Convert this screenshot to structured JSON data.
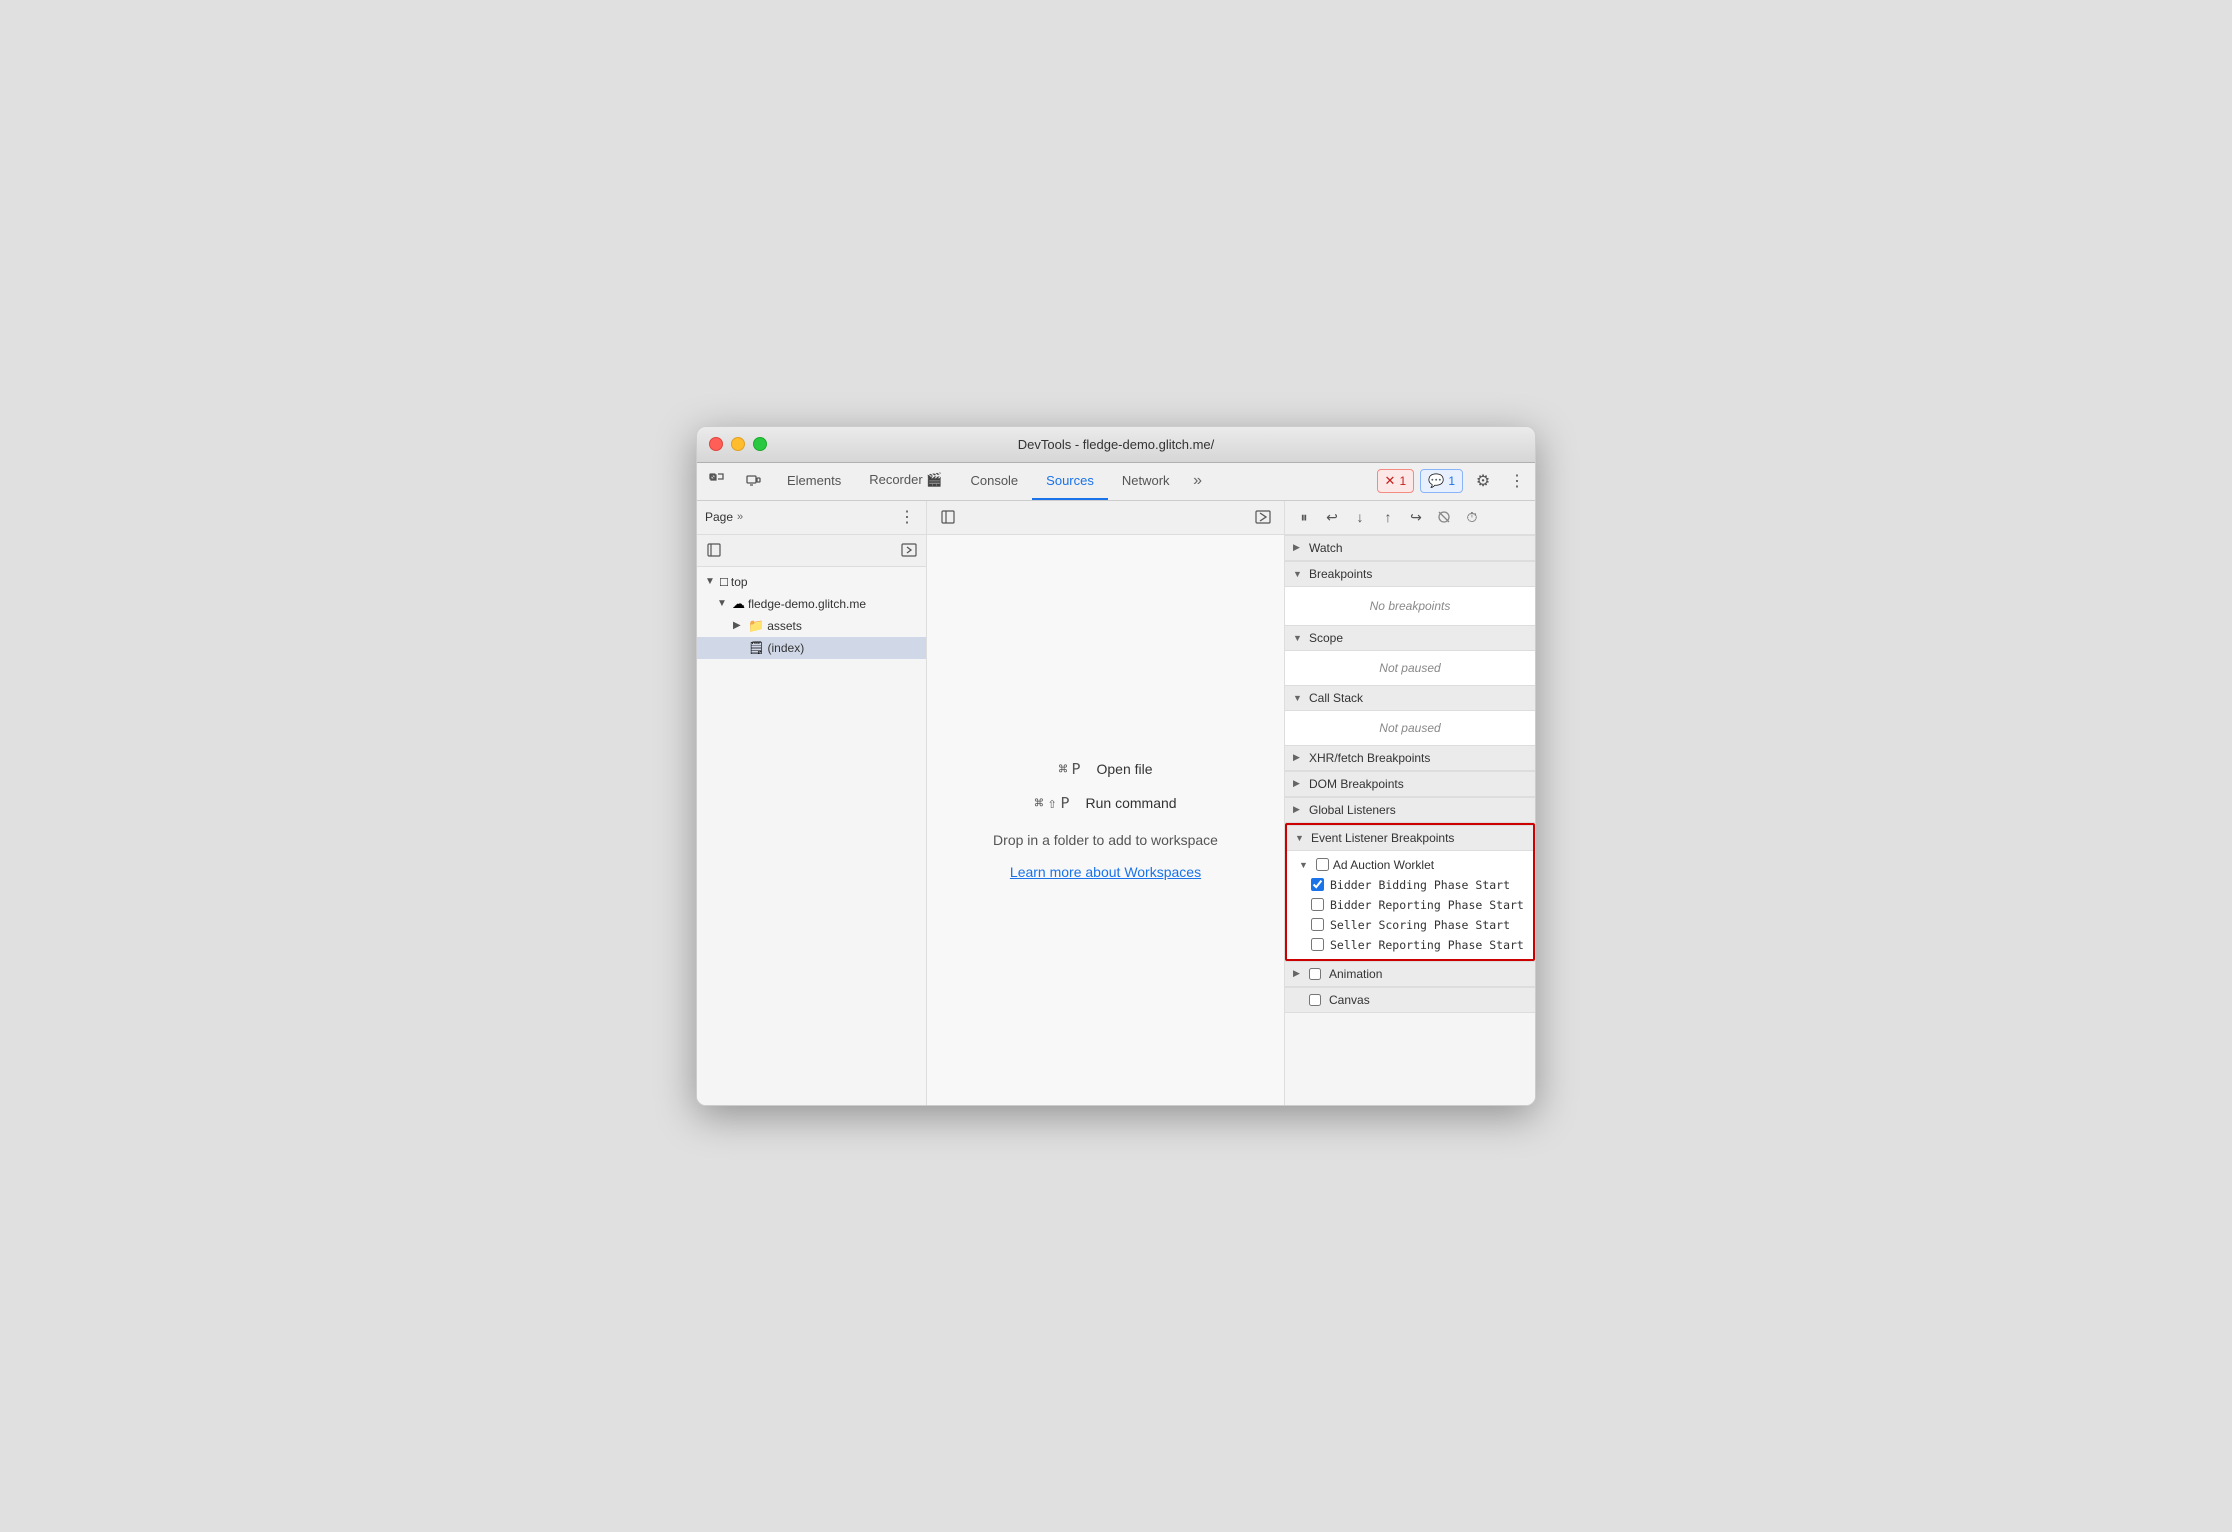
{
  "window": {
    "title": "DevTools - fledge-demo.glitch.me/"
  },
  "tabs": [
    {
      "label": "Elements",
      "active": false
    },
    {
      "label": "Recorder 🎬",
      "active": false
    },
    {
      "label": "Console",
      "active": false
    },
    {
      "label": "Sources",
      "active": true
    },
    {
      "label": "Network",
      "active": false
    }
  ],
  "badges": {
    "error": "1",
    "info": "1"
  },
  "sidebar": {
    "header": "Page",
    "tree": [
      {
        "label": "top",
        "indent": 0,
        "type": "arrow-down",
        "icon": "📄"
      },
      {
        "label": "fledge-demo.glitch.me",
        "indent": 1,
        "type": "arrow-down",
        "icon": "☁️"
      },
      {
        "label": "assets",
        "indent": 2,
        "type": "arrow-right",
        "icon": "📁"
      },
      {
        "label": "(index)",
        "indent": 2,
        "type": "none",
        "icon": "📄",
        "selected": true
      }
    ]
  },
  "middle": {
    "shortcut1_keys": "⌘ P",
    "shortcut1_label": "Open file",
    "shortcut2_keys": "⌘ ⇧ P",
    "shortcut2_label": "Run command",
    "drop_text": "Drop in a folder to add to workspace",
    "learn_link": "Learn more about Workspaces"
  },
  "right": {
    "sections": [
      {
        "id": "watch",
        "label": "Watch",
        "expanded": false
      },
      {
        "id": "breakpoints",
        "label": "Breakpoints",
        "expanded": true,
        "content": "No breakpoints"
      },
      {
        "id": "scope",
        "label": "Scope",
        "expanded": true,
        "content": "Not paused"
      },
      {
        "id": "call-stack",
        "label": "Call Stack",
        "expanded": true,
        "content": "Not paused"
      },
      {
        "id": "xhr-breakpoints",
        "label": "XHR/fetch Breakpoints",
        "expanded": false
      },
      {
        "id": "dom-breakpoints",
        "label": "DOM Breakpoints",
        "expanded": false
      },
      {
        "id": "global-listeners",
        "label": "Global Listeners",
        "expanded": false
      },
      {
        "id": "event-listener-breakpoints",
        "label": "Event Listener Breakpoints",
        "expanded": true,
        "highlighted": true
      }
    ],
    "event_listener_sub": {
      "label": "Ad Auction Worklet",
      "expanded": true,
      "items": [
        {
          "label": "Bidder Bidding Phase Start",
          "checked": true
        },
        {
          "label": "Bidder Reporting Phase Start",
          "checked": false
        },
        {
          "label": "Seller Scoring Phase Start",
          "checked": false
        },
        {
          "label": "Seller Reporting Phase Start",
          "checked": false
        }
      ]
    },
    "after_sections": [
      {
        "label": "Animation",
        "expanded": false
      },
      {
        "label": "Canvas",
        "expanded": false
      }
    ]
  }
}
